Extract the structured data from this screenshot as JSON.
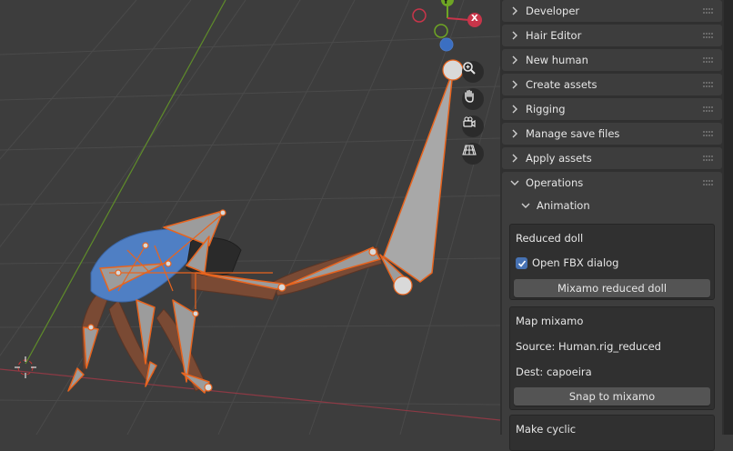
{
  "gizmo": {
    "y_axis": "Y",
    "x_axis": "X"
  },
  "nav_tools": [
    "zoom-icon",
    "hand-pan-icon",
    "camera-icon",
    "perspective-grid-icon"
  ],
  "colors": {
    "accent": "#4772b3",
    "bone_outline": "#e8641e",
    "x_axis": "#c8354a",
    "y_axis": "#6ea524",
    "z_axis": "#3b6fc2"
  },
  "sidebar": {
    "panels": [
      {
        "label": "Developer"
      },
      {
        "label": "Hair Editor"
      },
      {
        "label": "New human"
      },
      {
        "label": "Create assets"
      },
      {
        "label": "Rigging"
      },
      {
        "label": "Manage save files"
      },
      {
        "label": "Apply assets"
      }
    ],
    "operations": {
      "label": "Operations",
      "animation": {
        "label": "Animation",
        "reduced_doll": {
          "title": "Reduced doll",
          "checkbox_label": "Open FBX dialog",
          "checkbox_checked": true,
          "button": "Mixamo reduced doll"
        },
        "map_mixamo": {
          "title": "Map mixamo",
          "source": "Source: Human.rig_reduced",
          "dest": "Dest: capoeira",
          "button": "Snap to mixamo"
        },
        "make_cyclic": {
          "title": "Make cyclic"
        }
      }
    }
  }
}
